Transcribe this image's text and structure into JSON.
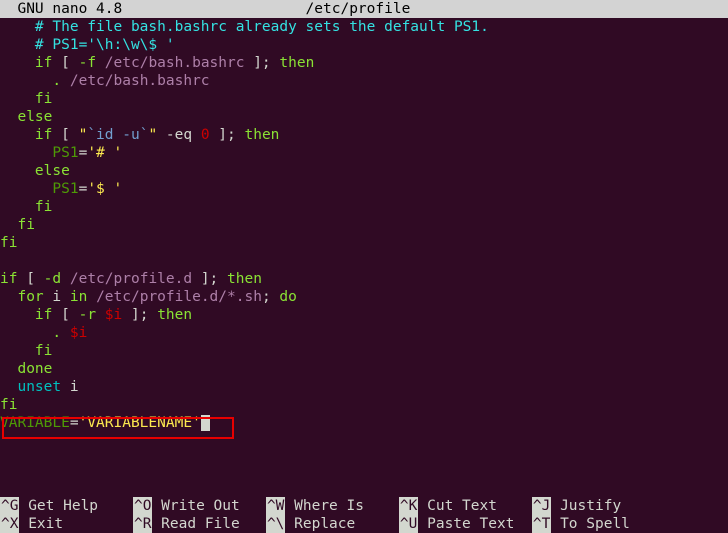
{
  "title_left": "  GNU nano 4.8",
  "title_path": "/etc/profile",
  "lines": [
    {
      "indent": "    ",
      "parts": [
        {
          "cls": "c-comment",
          "t": "# The file bash.bashrc already sets the default PS1."
        }
      ]
    },
    {
      "indent": "    ",
      "parts": [
        {
          "cls": "c-comment",
          "t": "# PS1='\\h:\\w\\$ '"
        }
      ]
    },
    {
      "indent": "    ",
      "parts": [
        {
          "cls": "c-brgreen",
          "t": "if"
        },
        {
          "cls": "c-white",
          "t": " [ "
        },
        {
          "cls": "c-brgreen",
          "t": "-f"
        },
        {
          "cls": "c-purple",
          "t": " /etc/bash.bashrc "
        },
        {
          "cls": "c-white",
          "t": "]; "
        },
        {
          "cls": "c-brgreen",
          "t": "then"
        }
      ]
    },
    {
      "indent": "      ",
      "parts": [
        {
          "cls": "c-brgreen",
          "t": "."
        },
        {
          "cls": "c-purple",
          "t": " /etc/bash.bashrc"
        }
      ]
    },
    {
      "indent": "    ",
      "parts": [
        {
          "cls": "c-brgreen",
          "t": "fi"
        }
      ]
    },
    {
      "indent": "  ",
      "parts": [
        {
          "cls": "c-brgreen",
          "t": "else"
        }
      ]
    },
    {
      "indent": "    ",
      "parts": [
        {
          "cls": "c-brgreen",
          "t": "if"
        },
        {
          "cls": "c-white",
          "t": " [ "
        },
        {
          "cls": "c-bryellow",
          "t": "\""
        },
        {
          "cls": "c-blue",
          "t": "`id -u`"
        },
        {
          "cls": "c-bryellow",
          "t": "\""
        },
        {
          "cls": "c-white",
          "t": " -eq "
        },
        {
          "cls": "c-red",
          "t": "0"
        },
        {
          "cls": "c-white",
          "t": " ]; "
        },
        {
          "cls": "c-brgreen",
          "t": "then"
        }
      ]
    },
    {
      "indent": "      ",
      "parts": [
        {
          "cls": "c-green",
          "t": "PS1"
        },
        {
          "cls": "c-white",
          "t": "="
        },
        {
          "cls": "c-bryellow",
          "t": "'# '"
        }
      ]
    },
    {
      "indent": "    ",
      "parts": [
        {
          "cls": "c-brgreen",
          "t": "else"
        }
      ]
    },
    {
      "indent": "      ",
      "parts": [
        {
          "cls": "c-green",
          "t": "PS1"
        },
        {
          "cls": "c-white",
          "t": "="
        },
        {
          "cls": "c-bryellow",
          "t": "'$ '"
        }
      ]
    },
    {
      "indent": "    ",
      "parts": [
        {
          "cls": "c-brgreen",
          "t": "fi"
        }
      ]
    },
    {
      "indent": "  ",
      "parts": [
        {
          "cls": "c-brgreen",
          "t": "fi"
        }
      ]
    },
    {
      "indent": "",
      "parts": [
        {
          "cls": "c-brgreen",
          "t": "fi"
        }
      ]
    },
    {
      "indent": "",
      "parts": []
    },
    {
      "indent": "",
      "parts": [
        {
          "cls": "c-brgreen",
          "t": "if"
        },
        {
          "cls": "c-white",
          "t": " [ "
        },
        {
          "cls": "c-brgreen",
          "t": "-d"
        },
        {
          "cls": "c-purple",
          "t": " /etc/profile.d "
        },
        {
          "cls": "c-white",
          "t": "]; "
        },
        {
          "cls": "c-brgreen",
          "t": "then"
        }
      ]
    },
    {
      "indent": "  ",
      "parts": [
        {
          "cls": "c-brgreen",
          "t": "for"
        },
        {
          "cls": "c-white",
          "t": " i "
        },
        {
          "cls": "c-brgreen",
          "t": "in"
        },
        {
          "cls": "c-purple",
          "t": " /etc/profile.d/*.sh"
        },
        {
          "cls": "c-white",
          "t": "; "
        },
        {
          "cls": "c-brgreen",
          "t": "do"
        }
      ]
    },
    {
      "indent": "    ",
      "parts": [
        {
          "cls": "c-brgreen",
          "t": "if"
        },
        {
          "cls": "c-white",
          "t": " [ "
        },
        {
          "cls": "c-brgreen",
          "t": "-r"
        },
        {
          "cls": "c-red",
          "t": " $i"
        },
        {
          "cls": "c-white",
          "t": " ]; "
        },
        {
          "cls": "c-brgreen",
          "t": "then"
        }
      ]
    },
    {
      "indent": "      ",
      "parts": [
        {
          "cls": "c-brgreen",
          "t": "."
        },
        {
          "cls": "c-red",
          "t": " $i"
        }
      ]
    },
    {
      "indent": "    ",
      "parts": [
        {
          "cls": "c-brgreen",
          "t": "fi"
        }
      ]
    },
    {
      "indent": "  ",
      "parts": [
        {
          "cls": "c-brgreen",
          "t": "done"
        }
      ]
    },
    {
      "indent": "  ",
      "parts": [
        {
          "cls": "c-cyan",
          "t": "unset"
        },
        {
          "cls": "c-white",
          "t": " i"
        }
      ]
    },
    {
      "indent": "",
      "parts": [
        {
          "cls": "c-brgreen",
          "t": "fi"
        }
      ]
    },
    {
      "indent": "",
      "parts": [
        {
          "cls": "c-green",
          "t": "VARIABLE"
        },
        {
          "cls": "c-white",
          "t": "="
        },
        {
          "cls": "c-bryellow",
          "t": "'VARIABLENAME'"
        }
      ],
      "cursor": true
    }
  ],
  "shortcuts_row1": [
    {
      "key": "^G",
      "label": " Get Help    "
    },
    {
      "key": "^O",
      "label": " Write Out   "
    },
    {
      "key": "^W",
      "label": " Where Is    "
    },
    {
      "key": "^K",
      "label": " Cut Text    "
    },
    {
      "key": "^J",
      "label": " Justify"
    }
  ],
  "shortcuts_row2": [
    {
      "key": "^X",
      "label": " Exit        "
    },
    {
      "key": "^R",
      "label": " Read File   "
    },
    {
      "key": "^\\",
      "label": " Replace     "
    },
    {
      "key": "^U",
      "label": " Paste Text  "
    },
    {
      "key": "^T",
      "label": " To Spell"
    }
  ]
}
